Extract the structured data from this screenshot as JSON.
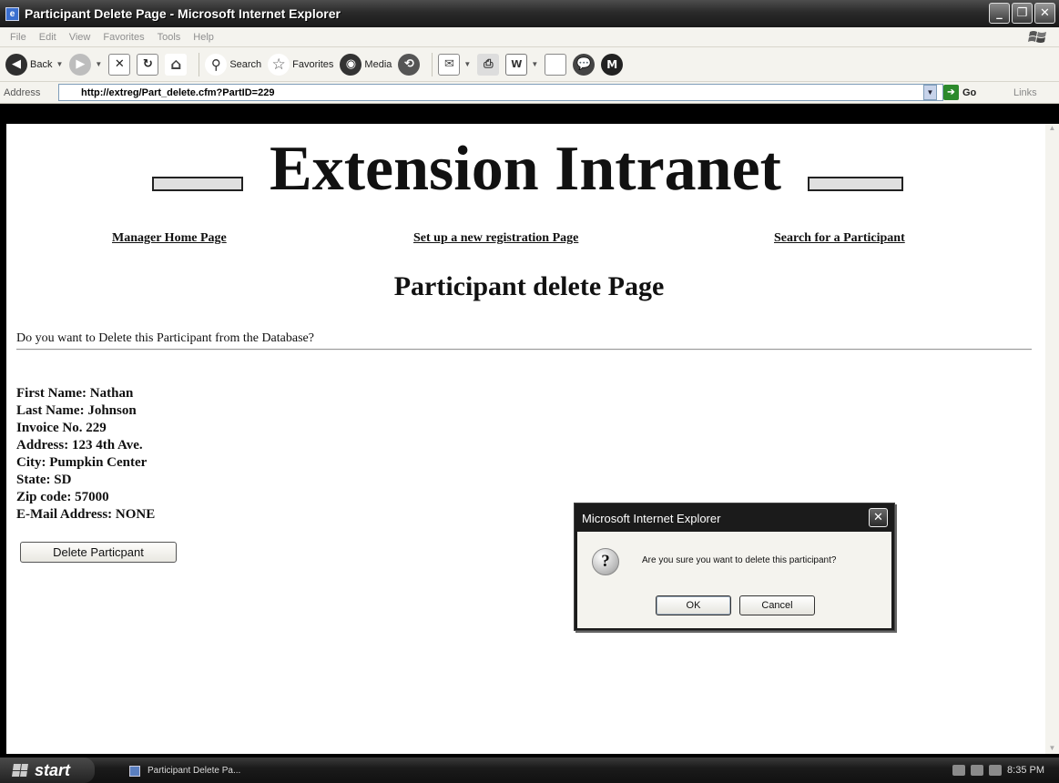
{
  "window": {
    "title": "Participant Delete Page - Microsoft Internet Explorer",
    "controls": [
      "_",
      "❐",
      "✕"
    ]
  },
  "menu": [
    "File",
    "Edit",
    "View",
    "Favorites",
    "Tools",
    "Help"
  ],
  "toolbar": {
    "back_label": "Back",
    "search_label": "Search",
    "favorites_label": "Favorites",
    "media_label": "Media"
  },
  "address": {
    "label": "Address",
    "url": "http://extreg/Part_delete.cfm?PartID=229",
    "go_label": "Go",
    "links_label": "Links"
  },
  "page": {
    "banner": "Extension Intranet",
    "nav": {
      "manager_home": "Manager Home Page",
      "new_registration": "Set up a new registration Page",
      "search_participant": "Search for a Participant"
    },
    "title": "Participant delete Page",
    "question": "Do you want to Delete this Participant from the Database?",
    "details": {
      "first_name": "First Name: Nathan",
      "last_name": "Last Name: Johnson",
      "invoice": "Invoice No. 229",
      "address": "Address: 123 4th Ave.",
      "city": "City: Pumpkin Center",
      "state": "State: SD",
      "zip": "Zip code: 57000",
      "email": "E-Mail Address: NONE"
    },
    "delete_button": "Delete Particpant"
  },
  "dialog": {
    "title": "Microsoft Internet Explorer",
    "message": "Are you sure you want to delete this participant?",
    "ok_label": "OK",
    "cancel_label": "Cancel"
  },
  "taskbar": {
    "start_label": "start",
    "task_item": "Participant Delete Pa...",
    "clock": "8:35 PM"
  }
}
